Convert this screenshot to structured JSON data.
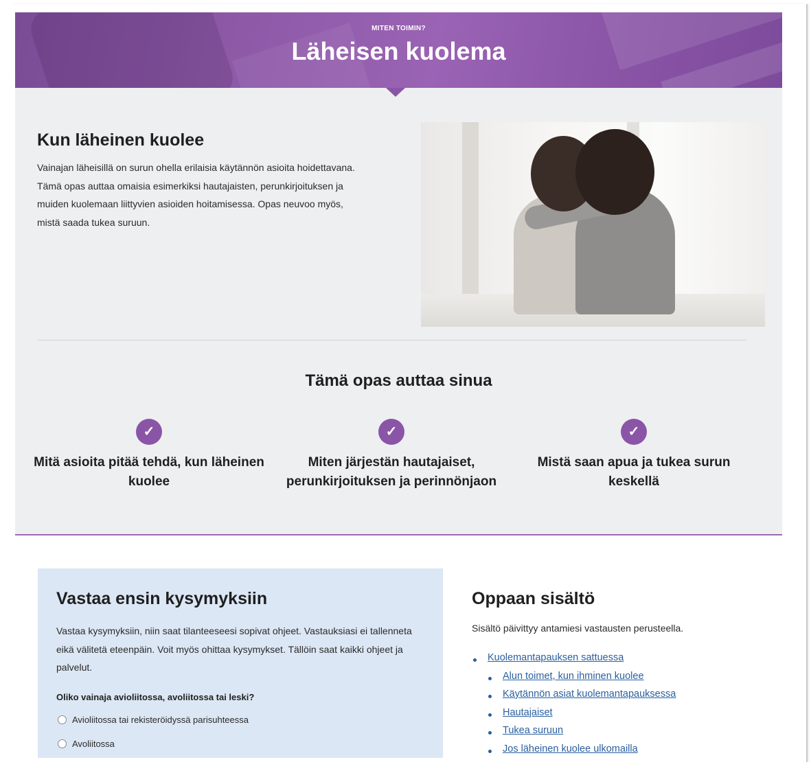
{
  "colors": {
    "brand_purple": "#8a55a6",
    "question_box_bg": "#dce7f5",
    "link": "#2a5f9e",
    "section_grey": "#eeeff1"
  },
  "hero": {
    "eyebrow": "MITEN TOIMIN?",
    "title": "Läheisen kuolema"
  },
  "intro": {
    "title": "Kun läheinen kuolee",
    "text": "Vainajan läheisillä on surun ohella erilaisia käytännön asioita hoidettavana. Tämä opas auttaa omaisia esimerkiksi hautajaisten, perunkirjoituksen ja muiden kuolemaan liittyvien asioiden hoitamisessa. Opas neuvoo myös, mistä saada tukea suruun."
  },
  "guide": {
    "title": "Tämä opas auttaa sinua",
    "benefits": [
      {
        "icon": "check-icon",
        "text": "Mitä asioita pitää tehdä, kun läheinen kuolee"
      },
      {
        "icon": "check-icon",
        "text": "Miten järjestän hautajaiset, perunkirjoituksen ja perinnönjaon"
      },
      {
        "icon": "check-icon",
        "text": "Mistä saan apua ja tukea surun keskellä"
      }
    ]
  },
  "questions": {
    "title": "Vastaa ensin kysymyksiin",
    "text": "Vastaa kysymyksiin, niin saat tilanteeseesi sopivat ohjeet. Vastauksiasi ei tallenneta eikä välitetä eteenpäin. Voit myös ohittaa kysymykset. Tällöin saat kaikki ohjeet ja palvelut.",
    "question": "Oliko vainaja avioliitossa, avoliitossa tai leski?",
    "options": [
      "Avioliitossa tai rekisteröidyssä parisuhteessa",
      "Avoliitossa"
    ]
  },
  "toc": {
    "title": "Oppaan sisältö",
    "note": "Sisältö päivittyy antamiesi vastausten perusteella.",
    "items": [
      "Kuolemantapauksen sattuessa",
      "Alun toimet, kun ihminen kuolee",
      "Käytännön asiat kuolemantapauksessa",
      "Hautajaiset",
      "Tukea suruun",
      "Jos läheinen kuolee ulkomailla"
    ]
  }
}
